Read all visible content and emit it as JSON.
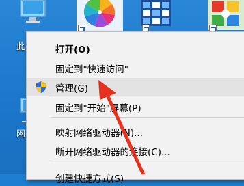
{
  "desktop": {
    "label_this_pc_partial": "此",
    "label_network_partial": "网"
  },
  "menu": {
    "items": [
      {
        "label": "打开(O)"
      },
      {
        "label": "固定到\"快速访问\""
      },
      {
        "label": "管理(G)"
      },
      {
        "label": "固定到\"开始\"屏幕(P)"
      },
      {
        "label": "映射网络驱动器(N)..."
      },
      {
        "label": "断开网络驱动器的连接(C)..."
      },
      {
        "label": "创建快捷方式(S)"
      }
    ]
  },
  "colors": {
    "arrow": "#e8301f",
    "menu_bg": "#f2f2f2",
    "hover_bg": "#e3e3e3",
    "shield_blue": "#2a6fd1",
    "shield_yellow": "#f2c230"
  },
  "icons": {
    "this_pc": "computer-icon",
    "pinwheel": "pinwheel-app-icon",
    "grid_app": "grid-app-icon",
    "photo_app": "photo-app-icon",
    "network": "network-icon",
    "shield": "uac-shield-icon"
  }
}
